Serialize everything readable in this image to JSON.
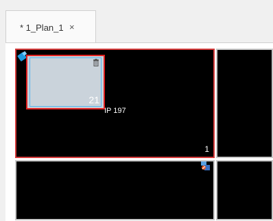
{
  "tabs": [
    {
      "label": "* 1_Plan_1",
      "close_label": "×"
    }
  ],
  "panes": [
    {
      "number": "1",
      "selected": true
    },
    {
      "number": "",
      "selected": false
    },
    {
      "number": "",
      "selected": false
    },
    {
      "number": "",
      "selected": false
    }
  ],
  "window": {
    "number": "21",
    "ip_text": "IP 197"
  },
  "colors": {
    "selection_border": "#d43a3a",
    "window_border": "#e02020",
    "pane_background": "#000000",
    "window_fill": "#c7d0d8"
  }
}
